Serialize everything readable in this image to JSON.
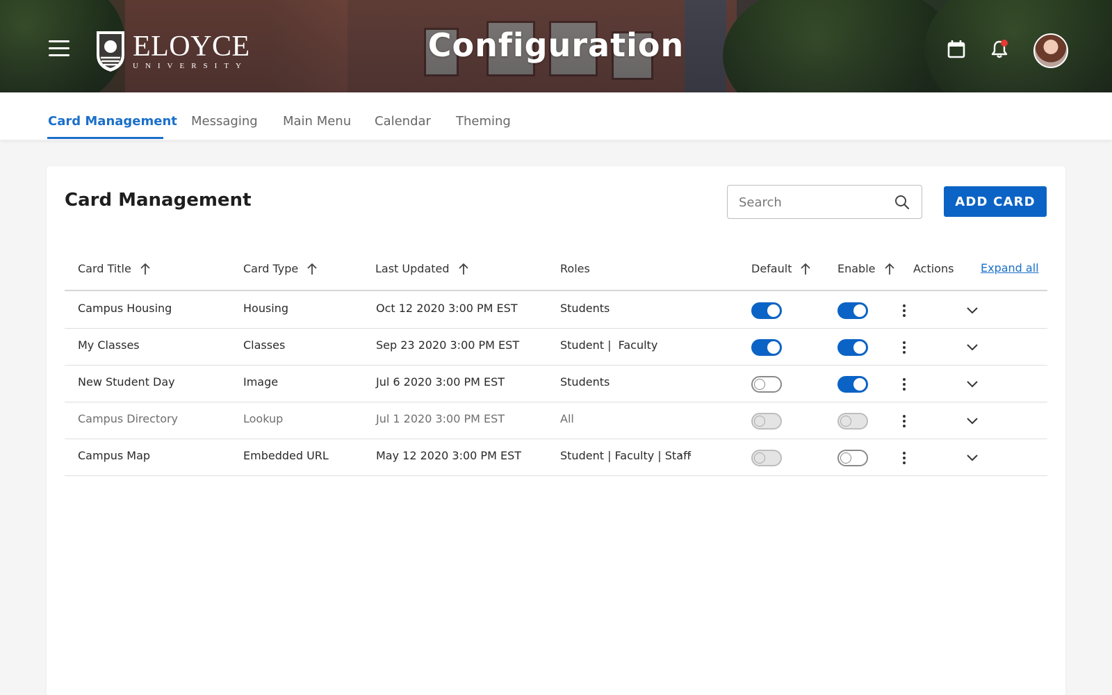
{
  "header": {
    "university_name": "ELOYCE",
    "university_sub": "UNIVERSITY",
    "page_title": "Configuration",
    "icons": [
      "menu-icon",
      "calendar-icon",
      "bell-icon",
      "avatar"
    ],
    "has_notification": true
  },
  "tabs": [
    {
      "label": "Card Management",
      "active": true
    },
    {
      "label": "Messaging",
      "active": false
    },
    {
      "label": "Main Menu",
      "active": false
    },
    {
      "label": "Calendar",
      "active": false
    },
    {
      "label": "Theming",
      "active": false
    }
  ],
  "panel": {
    "title": "Card Management",
    "search_placeholder": "Search",
    "add_button_label": "ADD CARD",
    "expand_all_label": "Expand all"
  },
  "table": {
    "columns": [
      "Card Title",
      "Card Type",
      "Last Updated",
      "Roles",
      "Default",
      "Enable",
      "Actions"
    ],
    "rows": [
      {
        "title": "Campus Housing",
        "type": "Housing",
        "updated": "Oct 12 2020 3:00 PM EST",
        "roles": "Students",
        "default": "on",
        "enable": "on",
        "dim": false
      },
      {
        "title": "My Classes",
        "type": "Classes",
        "updated": "Sep 23 2020 3:00 PM EST",
        "roles": "Student |  Faculty",
        "default": "on",
        "enable": "on",
        "dim": false
      },
      {
        "title": "New Student Day",
        "type": "Image",
        "updated": "Jul 6 2020 3:00 PM EST",
        "roles": "Students",
        "default": "off",
        "enable": "on",
        "dim": false
      },
      {
        "title": "Campus Directory",
        "type": "Lookup",
        "updated": "Jul 1 2020 3:00 PM EST",
        "roles": "All",
        "default": "disabled",
        "enable": "disabled",
        "dim": true
      },
      {
        "title": "Campus Map",
        "type": "Embedded URL",
        "updated": "May 12 2020 3:00 PM EST",
        "roles": "Student | Faculty | Staff",
        "default": "disabled",
        "enable": "off",
        "dim": false,
        "more_roles": "···"
      }
    ]
  },
  "colors": {
    "accent": "#0b63c5",
    "tab_active": "#1a6fc9",
    "notification_dot": "#e53935"
  }
}
